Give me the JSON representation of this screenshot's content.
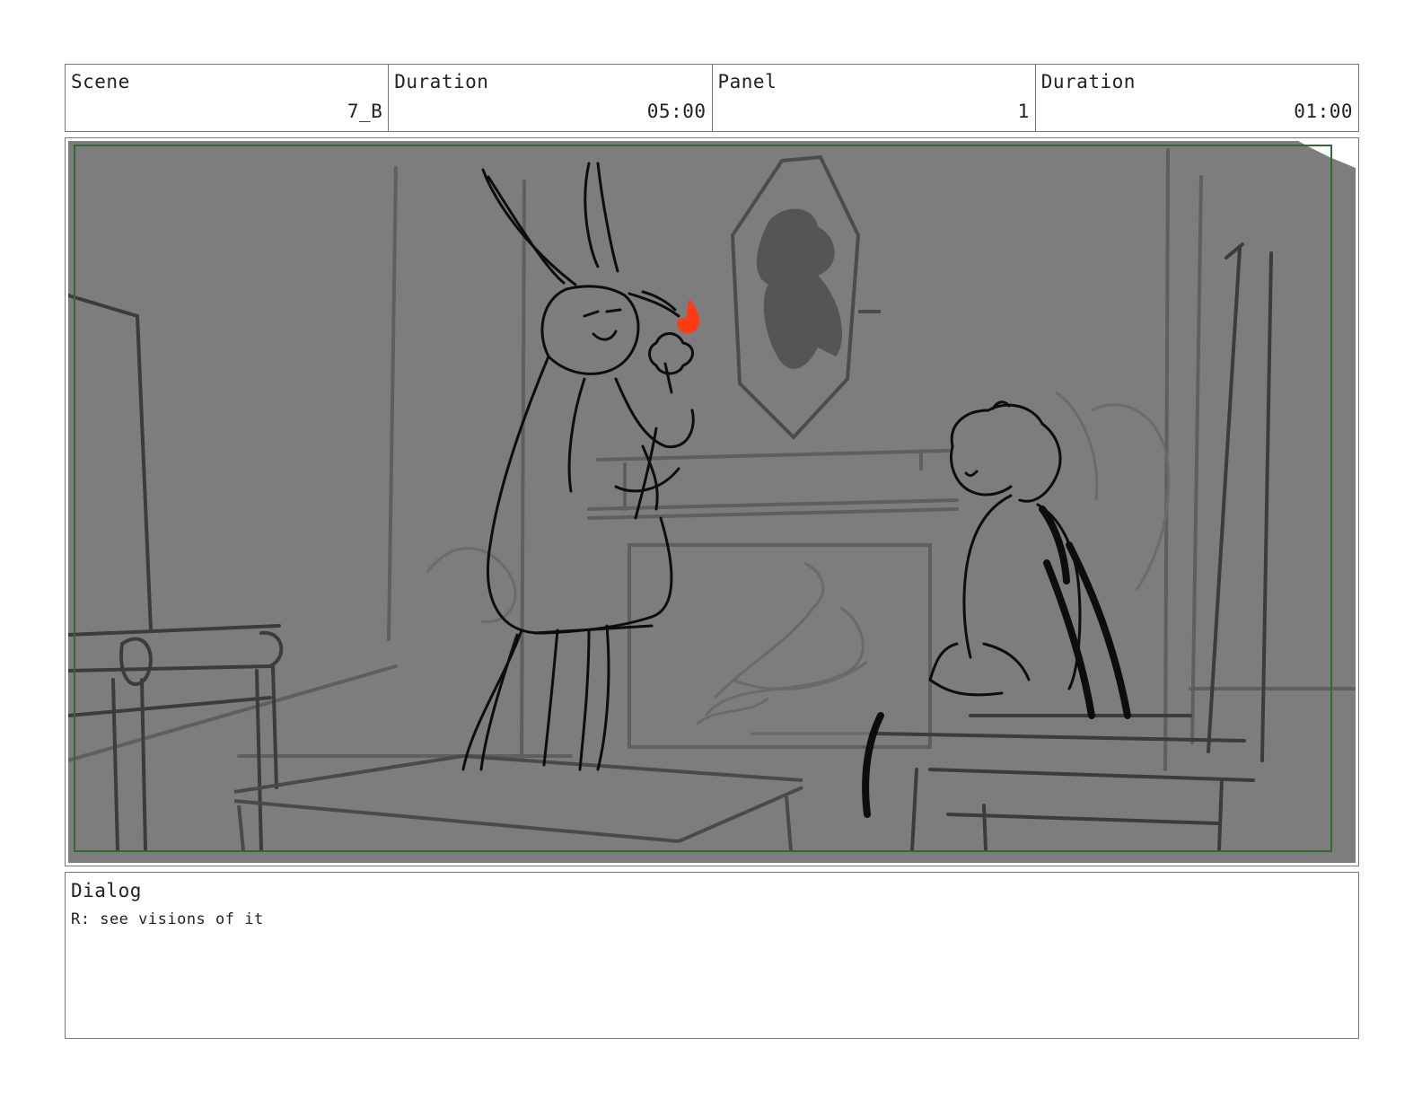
{
  "header": {
    "scene": {
      "label": "Scene",
      "value": "7_B"
    },
    "scene_duration": {
      "label": "Duration",
      "value": "05:00"
    },
    "panel": {
      "label": "Panel",
      "value": "1"
    },
    "panel_duration": {
      "label": "Duration",
      "value": "01:00"
    }
  },
  "panel_image": {
    "subject": "storyboard-sketch",
    "safe_area_color": "#2e6b2e",
    "highlight_color": "#ff3b14"
  },
  "dialog": {
    "label": "Dialog",
    "text": "R: see visions of it"
  }
}
